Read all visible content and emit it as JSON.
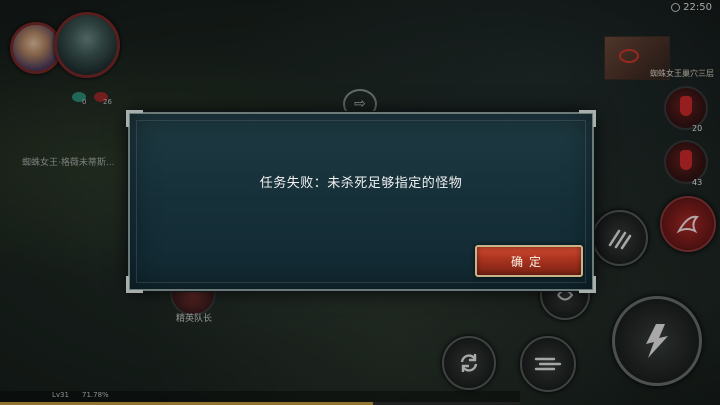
{
  "status": {
    "time": "22:50"
  },
  "minimap": {
    "location_label": "蜘蛛女王巢穴三层"
  },
  "player": {
    "buff_green_count": "0",
    "buff_red_count": "26",
    "level": "Lv31",
    "exp_percent": "71.78%",
    "exp_fraction": 0.7178
  },
  "quest": {
    "tracker_text": "蜘蛛女王·格薇未蒂斯..."
  },
  "elite": {
    "label": "精英队长"
  },
  "potions": [
    {
      "count": "20"
    },
    {
      "count": "43"
    }
  ],
  "dialog": {
    "message": "任务失败：未杀死足够指定的怪物",
    "confirm_label": "确定"
  },
  "icons": {
    "auto_path": "arrow-right-icon",
    "switch": "refresh-icon",
    "attack": "slash-icon",
    "skills": [
      "claw-icon",
      "swirl-icon",
      "dash-icon",
      "wing-icon"
    ]
  },
  "colors": {
    "dialog_border": "#6c7a78",
    "confirm_button": "#a8331f",
    "hp_accent": "#7a2a2a"
  }
}
